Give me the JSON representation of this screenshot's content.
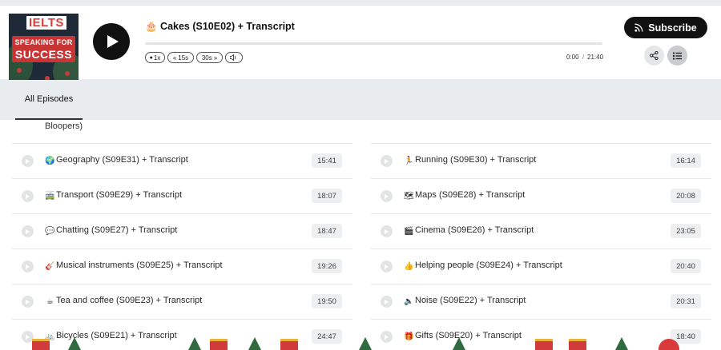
{
  "player": {
    "cover": {
      "brand": "IELTS",
      "line1": "SPEAKING FOR",
      "line2": "SUCCESS"
    },
    "episode_title": "🎂 Cakes (S10E02) + Transcript",
    "controls": {
      "speed": "1x",
      "back": "15s",
      "forward": "30s"
    },
    "time_current": "0:00",
    "time_separator": "/",
    "time_duration": "21:40",
    "subscribe_label": "Subscribe"
  },
  "tabs": [
    {
      "label": "All Episodes"
    }
  ],
  "list": {
    "partial_title": "Bloopers)",
    "left": [
      {
        "emoji": "🌍",
        "title": "Geography (S09E31) + Transcript",
        "duration": "15:41"
      },
      {
        "emoji": "🚎",
        "title": "Transport (S09E29) + Transcript",
        "duration": "18:07"
      },
      {
        "emoji": "💬",
        "title": "Chatting (S09E27) + Transcript",
        "duration": "18:47"
      },
      {
        "emoji": "🎸",
        "title": "Musical instruments (S09E25) + Transcript",
        "duration": "19:26"
      },
      {
        "emoji": "☕",
        "title": "Tea and coffee (S09E23) + Transcript",
        "duration": "19:50"
      },
      {
        "emoji": "🚲",
        "title": "Bicycles (S09E21) + Transcript",
        "duration": "24:47"
      }
    ],
    "right": [
      {
        "emoji": "🏃",
        "title": "Running (S09E30) + Transcript",
        "duration": "16:14"
      },
      {
        "emoji": "🗺",
        "title": "Maps (S09E28) + Transcript",
        "duration": "20:08"
      },
      {
        "emoji": "🎬",
        "title": "Cinema (S09E26) + Transcript",
        "duration": "23:05"
      },
      {
        "emoji": "👍",
        "title": "Helping people (S09E24) + Transcript",
        "duration": "20:40"
      },
      {
        "emoji": "🔈",
        "title": "Noise (S09E22) + Transcript",
        "duration": "20:31"
      },
      {
        "emoji": "🎁",
        "title": "Gifts (S09E20) + Transcript",
        "duration": "18:40"
      }
    ]
  },
  "colors": {
    "accent": "#111111",
    "page_bg": "#e9ecee",
    "duration_bg": "#eeeff1"
  }
}
